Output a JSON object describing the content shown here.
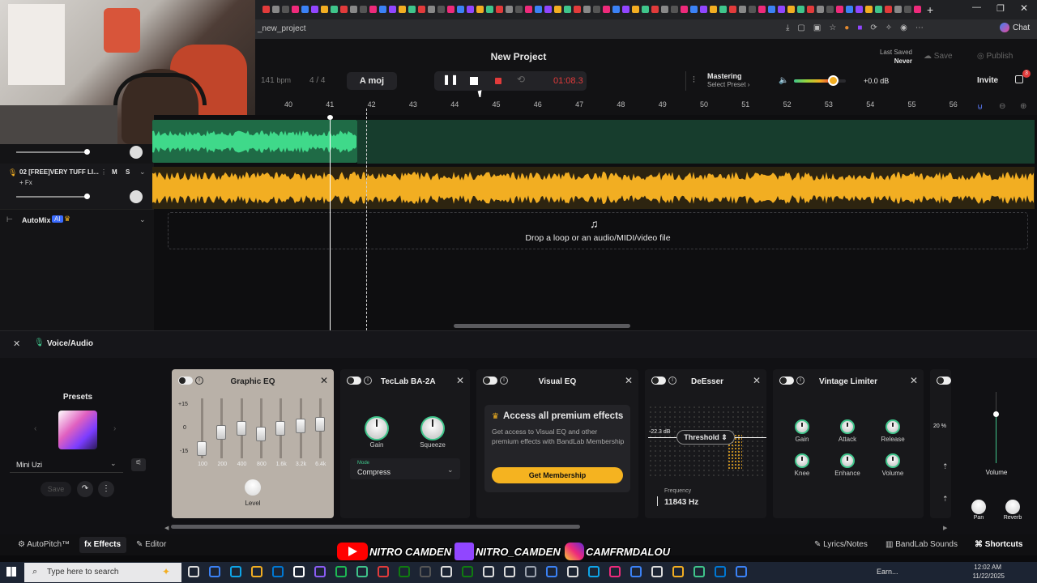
{
  "browser": {
    "url_text": "_new_project",
    "chat_label": "Chat"
  },
  "daw": {
    "project_title": "New Project",
    "bpm_value": "141",
    "bpm_unit": "bpm",
    "time_signature": "4 / 4",
    "key": "A moj",
    "time_display": "01:08.3",
    "mastering_label": "Mastering",
    "select_preset_label": "Select Preset",
    "volume_db": "+0.0 dB",
    "volume_level": 0.75,
    "last_saved_label": "Last Saved",
    "last_saved_value": "Never",
    "save_label": "Save",
    "publish_label": "Publish",
    "invite_label": "Invite",
    "notification_count": "3",
    "record_color": "#e23b3b",
    "accent_color": "#3fc58b",
    "track_green": "#2fb56c",
    "track_yellow": "#f2ae22"
  },
  "ruler": {
    "ticks": [
      "40",
      "41",
      "42",
      "43",
      "44",
      "45",
      "46",
      "47",
      "48",
      "49",
      "50",
      "51",
      "52",
      "53",
      "54",
      "55",
      "56"
    ]
  },
  "tracks": [
    {
      "name": "02 [FREE]VERY TUFF LI...",
      "mute": "M",
      "solo": "S",
      "fx": "+ Fx",
      "color": "#f2ae22"
    }
  ],
  "automix": {
    "label": "AutoMix",
    "ai_badge": "AI"
  },
  "drop_zone": {
    "text": "Drop a loop or an audio/MIDI/video file"
  },
  "fx_panel": {
    "title": "Voice/Audio",
    "presets_label": "Presets",
    "preset_name": "Mini Uzi",
    "save_label": "Save",
    "graphic_eq": {
      "title": "Graphic EQ",
      "scale": [
        "+15",
        "0",
        "-15"
      ],
      "bands": [
        "100",
        "200",
        "400",
        "800",
        "1.6k",
        "3.2k",
        "6.4k"
      ],
      "level_label": "Level"
    },
    "teclab": {
      "title": "TecLab BA-2A",
      "gain_label": "Gain",
      "squeeze_label": "Squeeze",
      "mode_label": "Mode",
      "mode_value": "Compress"
    },
    "visual_eq": {
      "title": "Visual EQ",
      "premium_title": "Access all premium effects",
      "premium_text": "Get access to Visual EQ and other premium effects with BandLab Membership",
      "membership_button": "Get Membership",
      "membership_color": "#f5b320"
    },
    "deesser": {
      "title": "DeEsser",
      "threshold_label": "Threshold",
      "db_value": "-22.3 dB",
      "frequency_label": "Frequency",
      "frequency_value": "11843 Hz"
    },
    "vintage_limiter": {
      "title": "Vintage Limiter",
      "knobs": [
        "Gain",
        "Attack",
        "Release",
        "Knee",
        "Enhance",
        "Volume"
      ]
    },
    "extra": {
      "percent": "20 %",
      "volume_label": "Volume",
      "pan_label": "Pan",
      "reverb_label": "Reverb"
    }
  },
  "footer": {
    "autopitch": "AutoPitch™",
    "effects": "Effects",
    "editor": "Editor",
    "lyrics": "Lyrics/Notes",
    "sounds": "BandLab Sounds",
    "shortcuts": "Shortcuts"
  },
  "overlay": {
    "youtube": "NITRO CAMDEN",
    "twitch": "NITRO_CAMDEN",
    "instagram": "CAMFRMDALOU"
  },
  "taskbar": {
    "search_placeholder": "Type here to search",
    "weather": "Earn...",
    "time": "12:02 AM",
    "date": "11/22/2025"
  }
}
